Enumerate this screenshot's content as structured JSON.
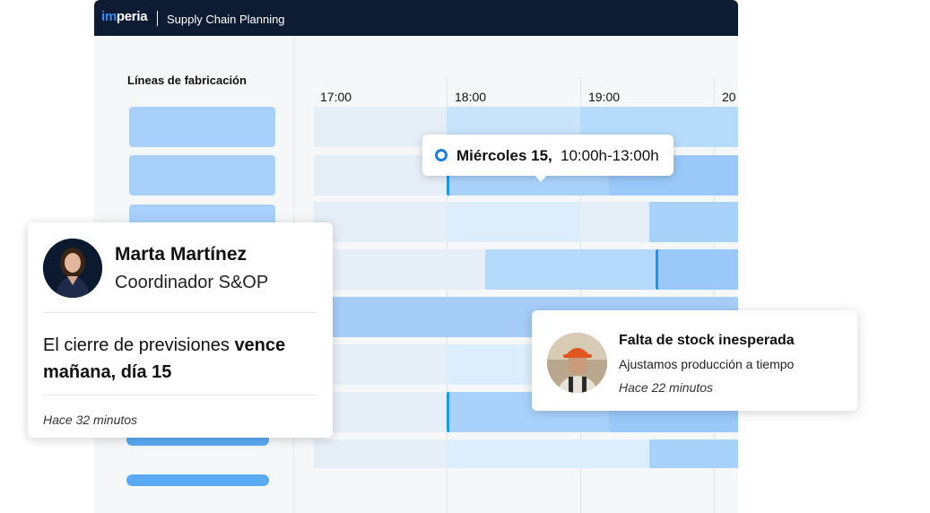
{
  "header": {
    "logo_prefix": "im",
    "logo_suffix": "peria",
    "app_title": "Supply Chain Planning"
  },
  "sidebar": {
    "heading": "Líneas de fabricación"
  },
  "timeline": {
    "hours": [
      "17:00",
      "18:00",
      "19:00",
      "20"
    ]
  },
  "tooltip": {
    "date": "Miércoles 15,",
    "time": "10:00h-13:00h"
  },
  "notification_marta": {
    "name": "Marta Martínez",
    "role": "Coordinador S&OP",
    "message_prefix": "El cierre de previsiones ",
    "message_bold": "vence mañana, día 15",
    "timestamp": "Hace 32 minutos"
  },
  "notification_stock": {
    "title": "Falta de stock inesperada",
    "message": "Ajustamos producción a tiempo",
    "timestamp": "Hace 22 minutos"
  },
  "colors": {
    "brand_dark": "#0d1b33",
    "brand_accent": "#2e8cf2",
    "bar_blue": "#a9d2fb",
    "active_edge": "#1f97e8"
  },
  "icons": {
    "tooltip_marker": "radio-dot-icon"
  }
}
